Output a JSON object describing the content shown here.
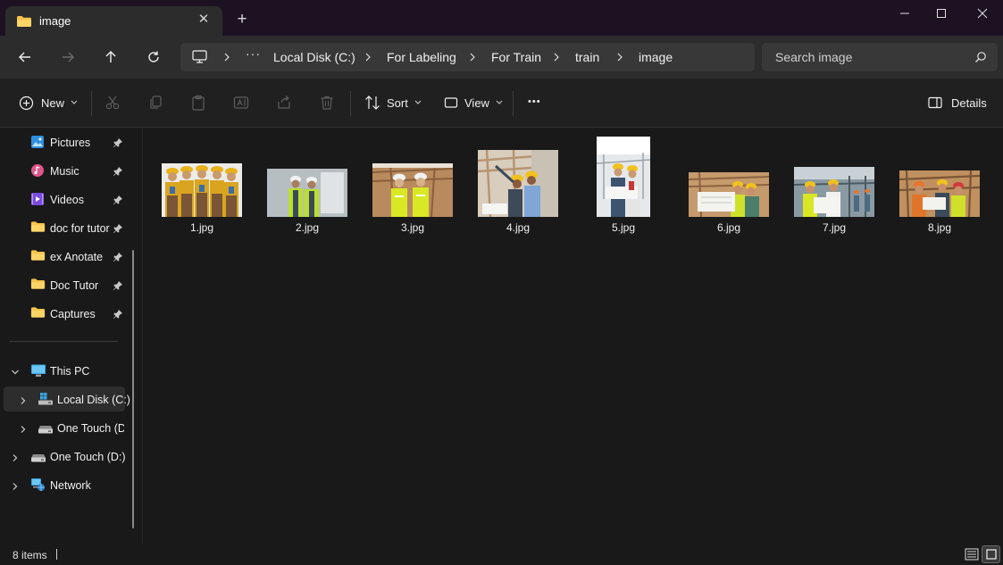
{
  "window": {
    "tab_title": "image",
    "tab_close": "✕",
    "new_tab": "+"
  },
  "address": {
    "breadcrumbs": [
      "Local Disk (C:)",
      "For Labeling",
      "For Train",
      "train",
      "image"
    ],
    "ellipsis": "···"
  },
  "search": {
    "placeholder": "Search image"
  },
  "commandbar": {
    "new_label": "New",
    "sort_label": "Sort",
    "view_label": "View",
    "more_label": "•••",
    "details_label": "Details"
  },
  "sidebar": {
    "quick_access": [
      {
        "label": "Pictures",
        "icon": "pictures-icon"
      },
      {
        "label": "Music",
        "icon": "music-icon"
      },
      {
        "label": "Videos",
        "icon": "videos-icon"
      },
      {
        "label": "doc for tutor",
        "icon": "folder-icon"
      },
      {
        "label": "ex Anotate",
        "icon": "folder-icon"
      },
      {
        "label": "Doc Tutor",
        "icon": "folder-icon"
      },
      {
        "label": "Captures",
        "icon": "folder-icon"
      }
    ],
    "this_pc": "This PC",
    "local_disk": "Local Disk (C:)",
    "one_touch_sub": "One Touch (D:)",
    "one_touch": "One Touch (D:)",
    "network": "Network"
  },
  "files": [
    {
      "name": "1.jpg"
    },
    {
      "name": "2.jpg"
    },
    {
      "name": "3.jpg"
    },
    {
      "name": "4.jpg"
    },
    {
      "name": "5.jpg"
    },
    {
      "name": "6.jpg"
    },
    {
      "name": "7.jpg"
    },
    {
      "name": "8.jpg"
    }
  ],
  "status": {
    "item_count": "8 items"
  },
  "colors": {
    "accent": "#4cc2ff",
    "folder": "#f8c44a",
    "background": "#191919",
    "toolbar": "#202020"
  }
}
